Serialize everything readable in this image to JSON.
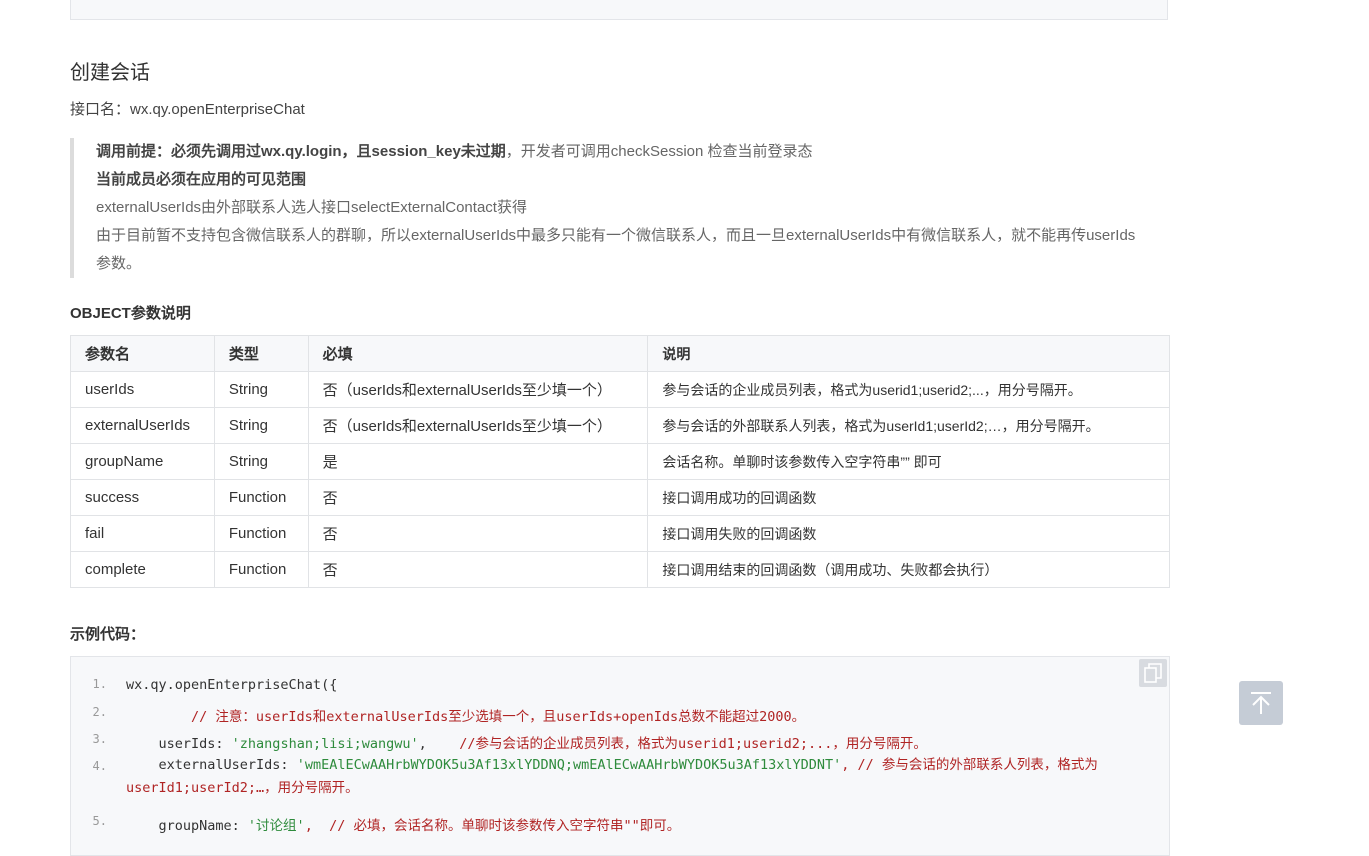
{
  "section": {
    "title": "创建会话",
    "api_label": "接口名：",
    "api_name": "wx.qy.openEnterpriseChat"
  },
  "notice": {
    "line1_bold": "调用前提：必须先调用过wx.qy.login，且session_key未过期",
    "line1_rest": "，开发者可调用checkSession 检查当前登录态",
    "line2_bold": "当前成员必须在应用的可见范围",
    "line3": "externalUserIds由外部联系人选人接口selectExternalContact获得",
    "line4": "由于目前暂不支持包含微信联系人的群聊，所以externalUserIds中最多只能有一个微信联系人，而且一旦externalUserIds中有微信联系人，就不能再传userIds参数。"
  },
  "object_title": "OBJECT参数说明",
  "table": {
    "headers": [
      "参数名",
      "类型",
      "必填",
      "说明"
    ],
    "rows": [
      [
        "userIds",
        "String",
        "否（userIds和externalUserIds至少填一个）",
        "参与会话的企业成员列表，格式为userid1;userid2;...，用分号隔开。"
      ],
      [
        "externalUserIds",
        "String",
        "否（userIds和externalUserIds至少填一个）",
        "参与会话的外部联系人列表，格式为userId1;userId2;…，用分号隔开。"
      ],
      [
        "groupName",
        "String",
        "是",
        "会话名称。单聊时该参数传入空字符串”” 即可"
      ],
      [
        "success",
        "Function",
        "否",
        "接口调用成功的回调函数"
      ],
      [
        "fail",
        "Function",
        "否",
        "接口调用失败的回调函数"
      ],
      [
        "complete",
        "Function",
        "否",
        "接口调用结束的回调函数（调用成功、失败都会执行）"
      ]
    ]
  },
  "example_title": "示例代码：",
  "code": {
    "line_numbers": [
      "1.",
      "2.",
      "3.",
      "4.",
      "5."
    ],
    "l1": "wx.qy.openEnterpriseChat({",
    "l2_comment": "        // 注意：userIds和externalUserIds至少选填一个，且userIds+openIds总数不能超过2000。",
    "l3_key": "    userIds: ",
    "l3_str": "'zhangshan;lisi;wangwu'",
    "l3_pad": ",    ",
    "l3_comment": "//参与会话的企业成员列表，格式为userid1;userid2;...，用分号隔开。",
    "l4_key": "    externalUserIds: ",
    "l4_str": "'wmEAlECwAAHrbWYDOK5u3Af13xlYDDNQ;wmEAlECwAAHrbWYDOK5u3Af13xlYDDNT'",
    "l4_comment": ", // 参与会话的外部联系人列表，格式为userId1;userId2;…，用分号隔开。",
    "l5_key": "    groupName: ",
    "l5_str": "'讨论组'",
    "l5_comment": ",  // 必填，会话名称。单聊时该参数传入空字符串\"\"即可。"
  }
}
